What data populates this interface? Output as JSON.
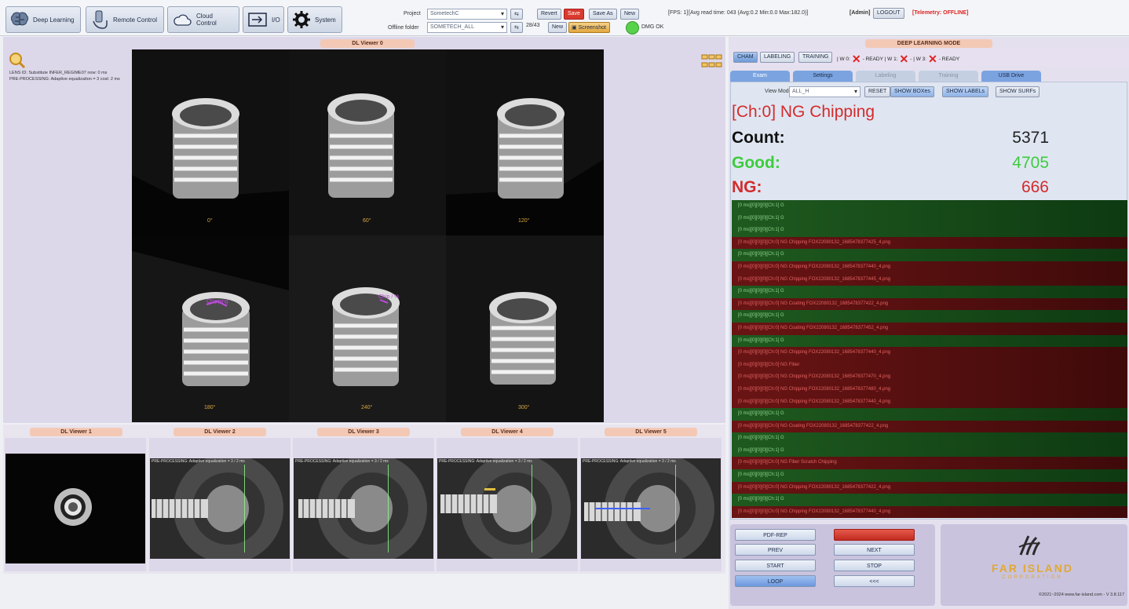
{
  "toolbar": {
    "deep_learning": "Deep Learning",
    "remote_control": "Remote Control",
    "cloud_control": "Cloud Control",
    "io": "I/O",
    "system": "System",
    "project_label": "Project",
    "project_value": "SometechC",
    "offline_folder_label": "Offline folder",
    "offline_folder_value": "SOMETECH_ALL",
    "folder_count": "28/43",
    "revert": "Revert",
    "save": "Save",
    "save_as": "Save As",
    "new1": "New",
    "new2": "New",
    "screenshot": "Screenshot",
    "dmg_status": "DMG OK",
    "fps": "[FPS: 1]",
    "avg_read": "[Avg read time: 043 (Avg:0.2 Min:0.0 Max:182.0)]",
    "admin": "[Admin]",
    "logout": "LOGOUT",
    "telemetry": "[Telemetry: OFFLINE]"
  },
  "main_viewer": {
    "title": "DL Viewer 0",
    "info_line1": "LENS ID: Substitute INFER_REGIME07 now: 0 ms",
    "info_line2": "PRE-PROCESSING:  Adaptive equalization = 3 cost: 2 ms",
    "angles": [
      "0°",
      "60°",
      "120°",
      "180°",
      "240°",
      "300°"
    ]
  },
  "sub_viewers": [
    {
      "title": "DL Viewer 1"
    },
    {
      "title": "DL Viewer 2",
      "info": "PRE-PROCESSING:  Adaptive equalization = 3 / 2 ms"
    },
    {
      "title": "DL Viewer 3",
      "info": "PRE-PROCESSING:  Adaptive equalization = 3 / 2 ms"
    },
    {
      "title": "DL Viewer 4",
      "info": "PRE-PROCESSING:  Adaptive equalization = 3 / 2 ms"
    },
    {
      "title": "DL Viewer 5",
      "info": "PRE-PROCESSING:  Adaptive equalization = 3 / 2 ms"
    }
  ],
  "right": {
    "mode_title": "DEEP LEARNING MODE",
    "mode_tabs": [
      "CHAM",
      "LABELING",
      "TRAINING"
    ],
    "worker_status": [
      "| W 0:",
      "- READY | W 1:",
      "- | W 3:",
      "- READY"
    ],
    "subtabs": [
      "Exam",
      "Settings",
      "Labeling",
      "Training",
      "USB Drive"
    ],
    "view_mode_label": "View Mode",
    "view_mode_value": "ALL_H",
    "reset": "RESET",
    "show_boxes": "SHOW BOXes",
    "show_labels": "SHOW LABELs",
    "show_surfs": "SHOW SURFs",
    "result": "[Ch:0] NG Chipping",
    "count_label": "Count:",
    "count_value": "5371",
    "good_label": "Good:",
    "good_value": "4705",
    "ng_label": "NG:",
    "ng_value": "666",
    "colors": {
      "good": "#3dcc3d",
      "ng": "#d42b2b",
      "result": "#d42b2b"
    }
  },
  "log": [
    {
      "type": "good",
      "text": "[0 ms][0][0][0][Ch:1] G"
    },
    {
      "type": "good",
      "text": "[0 ms][0][0][0][Ch:1] G"
    },
    {
      "type": "good",
      "text": "[0 ms][0][0][0][Ch:1] G"
    },
    {
      "type": "ng",
      "text": "[0 ms][0][0][0][Ch:0] NG Chipping  FOX22080132_1685478377425_4.png"
    },
    {
      "type": "good",
      "text": "[0 ms][0][0][0][Ch:1] G"
    },
    {
      "type": "ng",
      "text": "[0 ms][0][0][0][Ch:0] NG Chipping  FOX22080132_1685478377440_4.png"
    },
    {
      "type": "ng",
      "text": "[0 ms][0][0][0][Ch:0] NG Chipping  FOX22080132_1685478377445_4.png"
    },
    {
      "type": "good",
      "text": "[0 ms][0][0][0][Ch:1] G"
    },
    {
      "type": "ng",
      "text": "[0 ms][0][0][0][Ch:0] NG Coating  FOX22080132_1685478377422_4.png"
    },
    {
      "type": "good",
      "text": "[0 ms][0][0][0][Ch:1] G"
    },
    {
      "type": "ng",
      "text": "[0 ms][0][0][0][Ch:0] NG Coating  FOX22080132_1685478377452_4.png"
    },
    {
      "type": "good",
      "text": "[0 ms][0][0][0][Ch:1] G"
    },
    {
      "type": "ng",
      "text": "[0 ms][0][0][0][Ch:0] NG Chipping  FOX22080132_1685478377440_4.png"
    },
    {
      "type": "ng",
      "text": "[0 ms][0][0][0][Ch:0] NG Fiber"
    },
    {
      "type": "ng",
      "text": "[0 ms][0][0][0][Ch:0] NG Chipping  FOX22080132_1685478377470_4.png"
    },
    {
      "type": "ng",
      "text": "[0 ms][0][0][0][Ch:0] NG Chipping  FOX22080132_1685478377480_4.png"
    },
    {
      "type": "ng",
      "text": "[0 ms][0][0][0][Ch:0] NG Chipping  FOX22080132_1685478377440_4.png"
    },
    {
      "type": "good",
      "text": "[0 ms][0][0][0][Ch:1] G"
    },
    {
      "type": "ng",
      "text": "[0 ms][0][0][0][Ch:0] NG Coating  FOX22080132_1685478377422_4.png"
    },
    {
      "type": "good",
      "text": "[0 ms][0][0][0][Ch:1] G"
    },
    {
      "type": "good",
      "text": "[0 ms][0][0][0][Ch:1] G"
    },
    {
      "type": "ng",
      "text": "[0 ms][0][0][0][Ch:0] NG Fiber Scratch Chipping"
    },
    {
      "type": "good",
      "text": "[0 ms][0][0][0][Ch:1] G"
    },
    {
      "type": "ng",
      "text": "[0 ms][0][0][0][Ch:0] NG Chipping  FOX22080132_1685478377422_4.png"
    },
    {
      "type": "good",
      "text": "[0 ms][0][0][0][Ch:1] G"
    },
    {
      "type": "ng",
      "text": "[0 ms][0][0][0][Ch:0] NG Chipping  FOX22080132_1685478377440_4.png"
    }
  ],
  "controls": {
    "pdf_rep": "PDF-REP",
    "prev": "PREV",
    "start": "START",
    "loop": "LOOP",
    "next": "NEXT",
    "stop": "STOP",
    "more": "<<<"
  },
  "brand": {
    "name": "FAR ISLAND",
    "sub": "CORPORATION",
    "copyright": "©2021~2024 www.far-island.com - V 3.8.117"
  }
}
